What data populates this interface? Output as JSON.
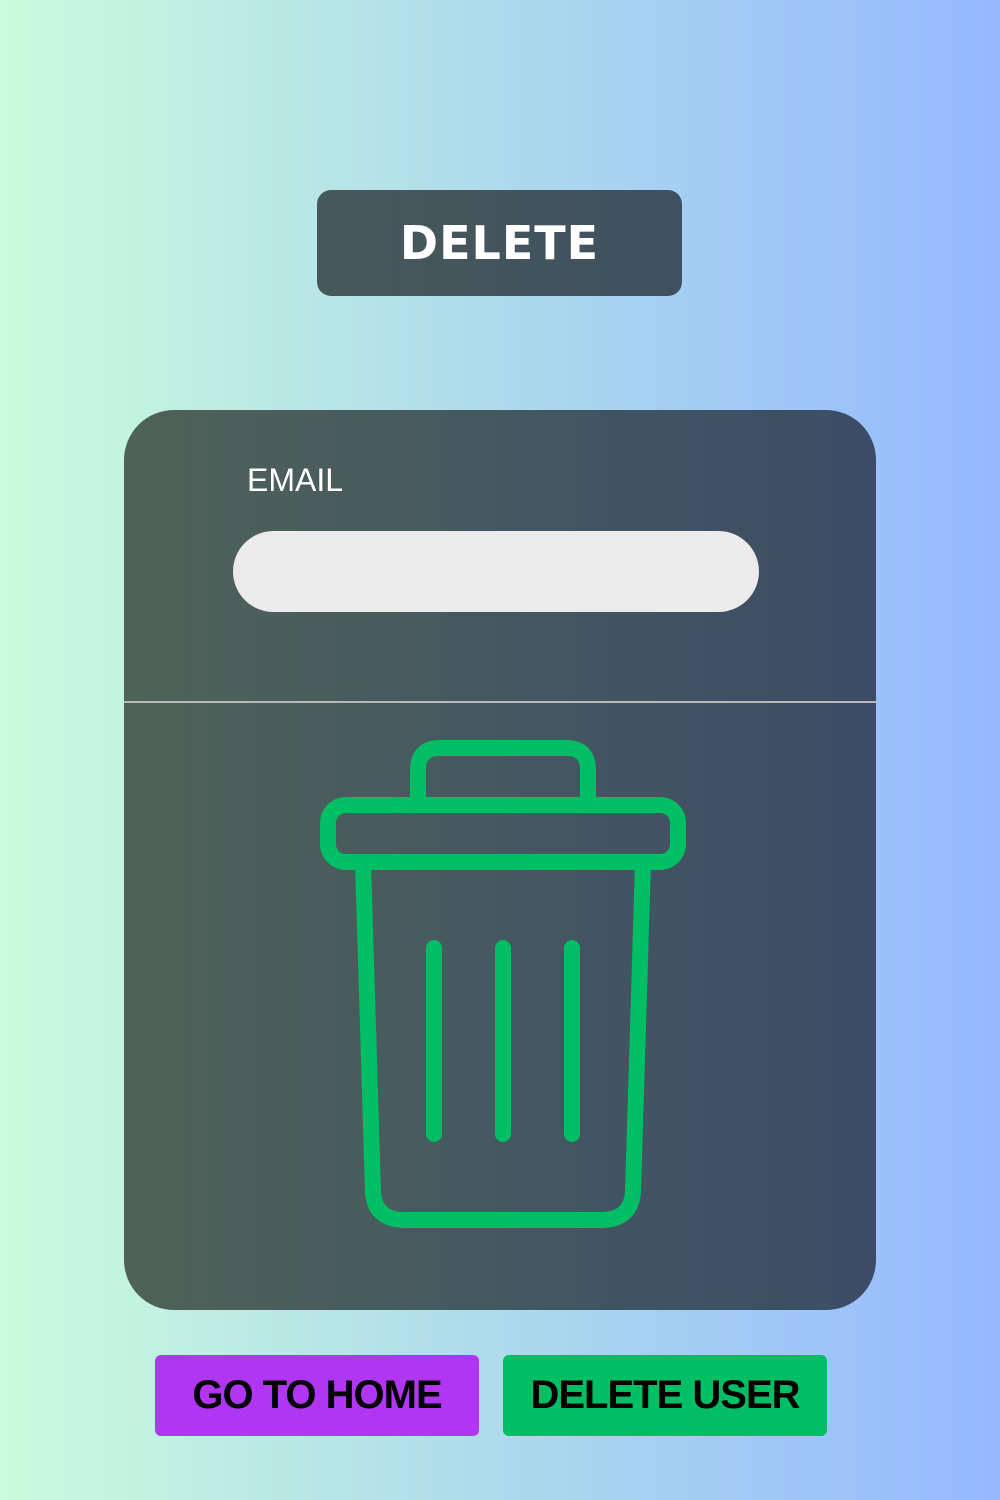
{
  "header": {
    "title": "DELETE"
  },
  "form": {
    "email_label": "EMAIL",
    "email_value": "",
    "email_placeholder": ""
  },
  "icons": {
    "main_icon": "trash-can-icon"
  },
  "buttons": {
    "home_label": "GO TO HOME",
    "delete_label": "DELETE USER"
  },
  "colors": {
    "icon_green": "#00be63",
    "home_button": "#b136f4",
    "delete_button": "#00be63",
    "card_dark": "#475a5f",
    "input_background": "#ebebeb"
  }
}
